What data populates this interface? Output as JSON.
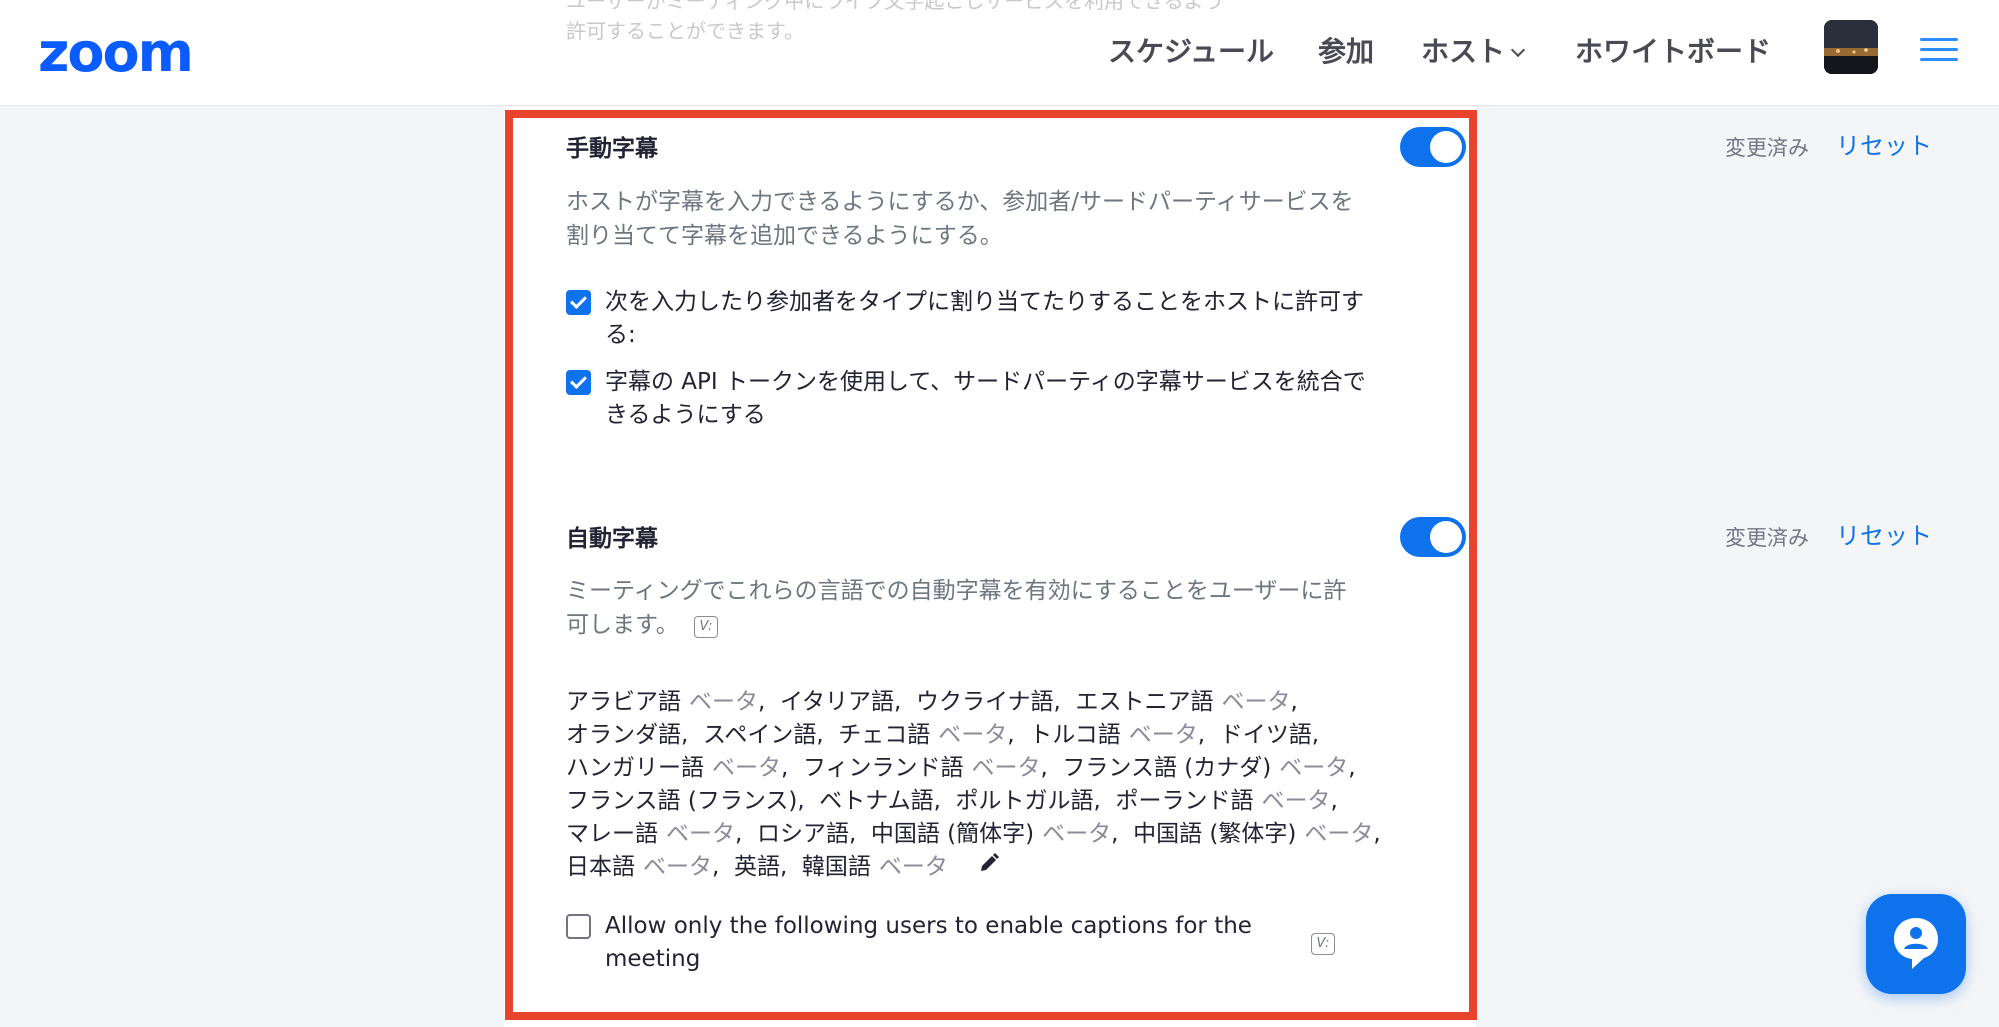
{
  "header": {
    "logo": "zoom",
    "ghost_line1": "ユーザーがミーティング中にライブ文字起こしサービスを利用できるよう",
    "ghost_line2": "許可することができます。",
    "nav": {
      "schedule": "スケジュール",
      "join": "参加",
      "host": "ホスト",
      "whiteboard": "ホワイトボード"
    },
    "avatar_icon": "avatar-image",
    "menu_icon": "hamburger-icon"
  },
  "manual_captions": {
    "title": "手動字幕",
    "description": "ホストが字幕を入力できるようにするか、参加者/サードパーティサービスを割り当てて字幕を追加できるようにする。",
    "enabled": true,
    "status": "変更済み",
    "reset": "リセット",
    "options": [
      {
        "label": "次を入力したり参加者をタイプに割り当てたりすることをホストに許可する:",
        "checked": true
      },
      {
        "label": "字幕の API トークンを使用して、サードパーティの字幕サービスを統合できるようにする",
        "checked": true
      }
    ]
  },
  "auto_captions": {
    "title": "自動字幕",
    "description": "ミーティングでこれらの言語での自動字幕を有効にすることをユーザーに許可します。",
    "enabled": true,
    "status": "変更済み",
    "reset": "リセット",
    "beta_label": "ベータ",
    "languages": [
      {
        "name": "アラビア語",
        "beta": true
      },
      {
        "name": "イタリア語",
        "beta": false
      },
      {
        "name": "ウクライナ語",
        "beta": false
      },
      {
        "name": "エストニア語",
        "beta": true
      },
      {
        "name": "オランダ語",
        "beta": false
      },
      {
        "name": "スペイン語",
        "beta": false
      },
      {
        "name": "チェコ語",
        "beta": true
      },
      {
        "name": "トルコ語",
        "beta": true
      },
      {
        "name": "ドイツ語",
        "beta": false
      },
      {
        "name": "ハンガリー語",
        "beta": true
      },
      {
        "name": "フィンランド語",
        "beta": true
      },
      {
        "name": "フランス語 (カナダ)",
        "beta": true
      },
      {
        "name": "フランス語 (フランス)",
        "beta": false
      },
      {
        "name": "ベトナム語",
        "beta": false
      },
      {
        "name": "ポルトガル語",
        "beta": false
      },
      {
        "name": "ポーランド語",
        "beta": true
      },
      {
        "name": "マレー語",
        "beta": true
      },
      {
        "name": "ロシア語",
        "beta": false
      },
      {
        "name": "中国語 (簡体字)",
        "beta": true
      },
      {
        "name": "中国語 (繁体字)",
        "beta": true
      },
      {
        "name": "日本語",
        "beta": true
      },
      {
        "name": "英語",
        "beta": false
      },
      {
        "name": "韓国語",
        "beta": true
      }
    ],
    "restrict_option": {
      "label": "Allow only the following users to enable captions for the meeting",
      "checked": false
    }
  },
  "colors": {
    "accent": "#0e72ed",
    "logo": "#0b5cff",
    "highlight_border": "#e8432d"
  }
}
